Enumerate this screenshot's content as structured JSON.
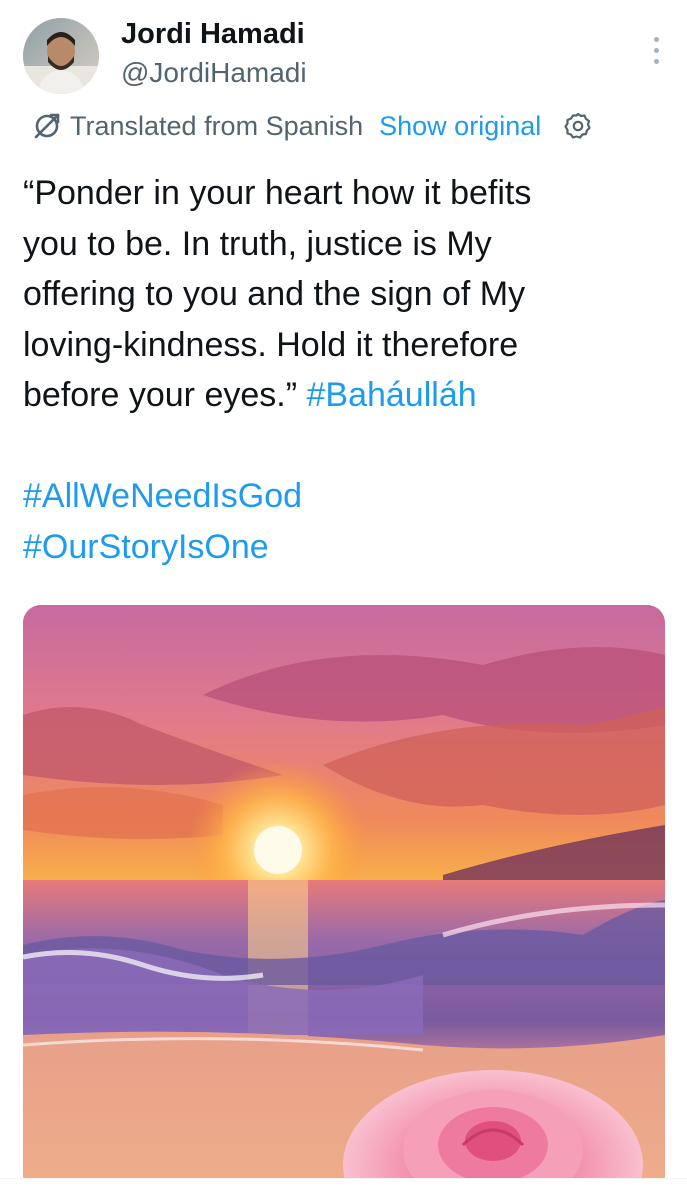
{
  "author": {
    "display_name": "Jordi Hamadi",
    "handle": "@JordiHamadi"
  },
  "translation": {
    "label": "Translated from Spanish",
    "show_original_label": "Show original"
  },
  "tweet": {
    "text_lines": [
      "“Ponder in your heart how it befits",
      "you to be. In truth, justice is My",
      "offering to you and the sign of My",
      "loving-kindness. Hold it therefore",
      "before your eyes.”"
    ],
    "inline_hashtag": "#Baháulláh",
    "hashtags": [
      "#AllWeNeedIsGod",
      "#OurStoryIsOne"
    ]
  },
  "colors": {
    "link": "#1d9bf0",
    "secondary_text": "#536471",
    "primary_text": "#0f1419"
  },
  "icons": {
    "translate": "translate-icon",
    "settings": "gear-icon",
    "more": "more-vertical-icon"
  },
  "media": {
    "type": "image",
    "subject": "sunset-over-sea-with-pink-rose"
  }
}
